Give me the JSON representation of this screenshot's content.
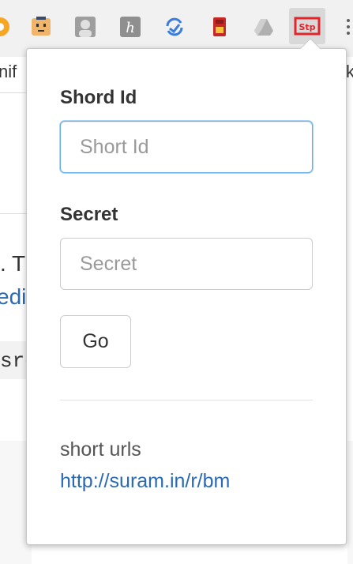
{
  "toolbar": {
    "icons": [
      "extension-orange-icon",
      "face-extension-icon",
      "avatar-extension-icon",
      "h-extension-icon",
      "sync-extension-icon",
      "sd-card-extension-icon",
      "drive-extension-icon",
      "stp-extension-icon"
    ],
    "active_extension_label": "Stp"
  },
  "background_page": {
    "tab_text_left": "nif",
    "tab_text_right": "k",
    "line_text": ". T",
    "link_text": "edi",
    "code_text": "sro"
  },
  "popup": {
    "short_id": {
      "label": "Shord Id",
      "placeholder": "Short Id",
      "value": ""
    },
    "secret": {
      "label": "Secret",
      "placeholder": "Secret",
      "value": ""
    },
    "go_label": "Go",
    "links_section": {
      "title": "short urls",
      "links": [
        "http://suram.in/r/bm"
      ]
    }
  },
  "colors": {
    "accent_focus": "#66afe9",
    "link": "#2a69b4",
    "stp_red": "#e0252b"
  }
}
